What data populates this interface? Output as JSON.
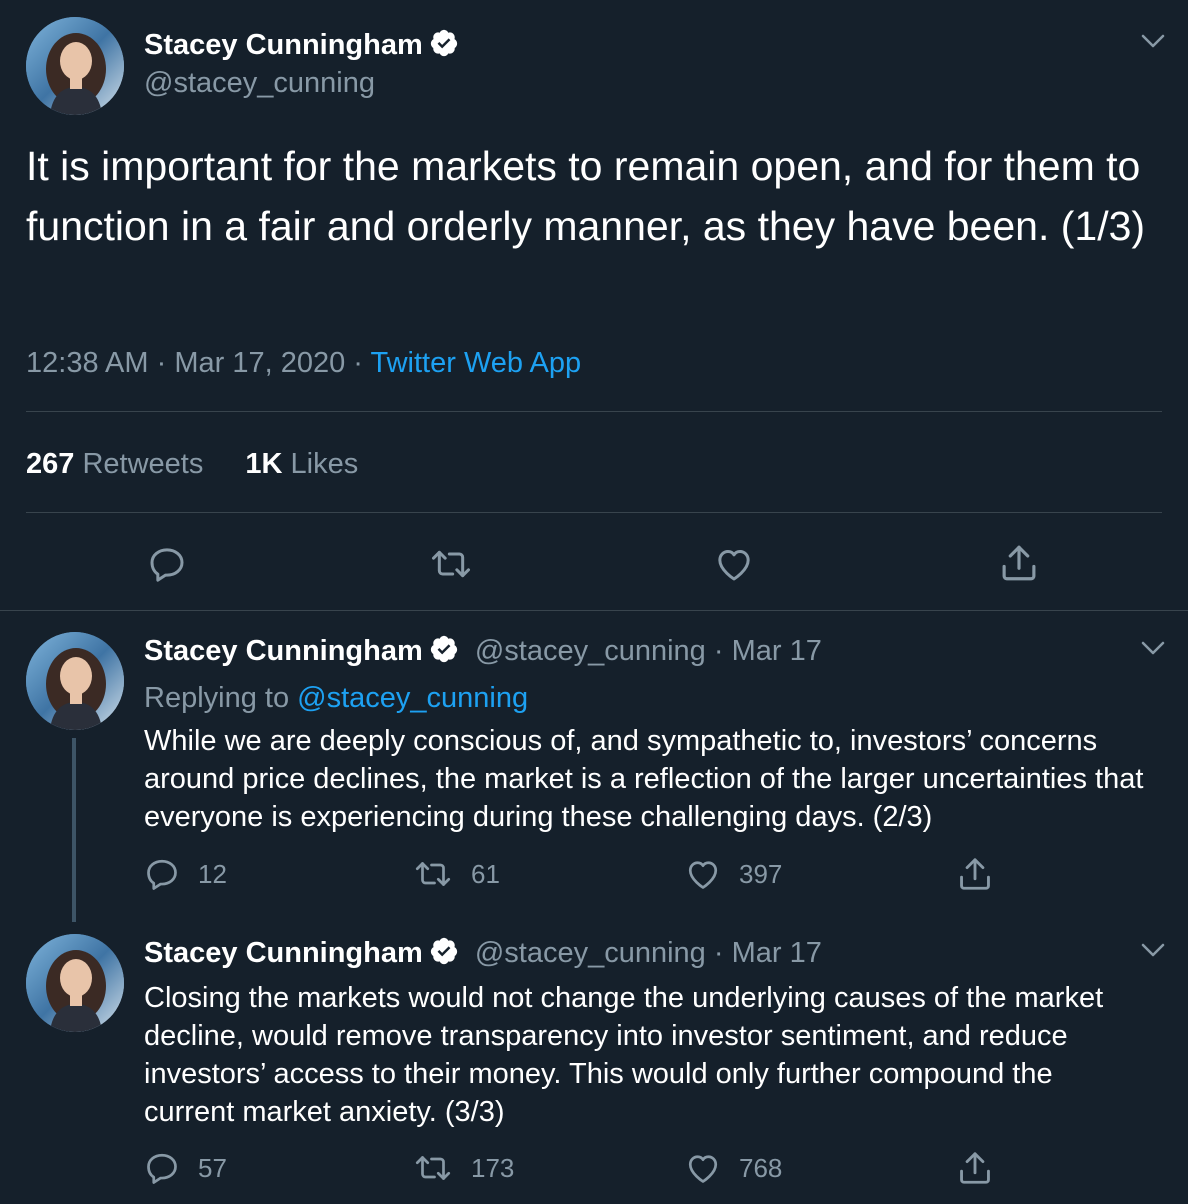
{
  "main_tweet": {
    "author_name": "Stacey Cunningham",
    "handle": "@stacey_cunning",
    "text": "It is important for the markets to remain open, and for them to function in a fair and orderly manner, as they have been. (1/3)",
    "time": "12:38 AM",
    "date": "Mar 17, 2020",
    "source": "Twitter Web App",
    "retweets_count": "267",
    "retweets_label": "Retweets",
    "likes_count": "1K",
    "likes_label": "Likes"
  },
  "replies": [
    {
      "author_name": "Stacey Cunningham",
      "handle": "@stacey_cunning",
      "date": "Mar 17",
      "replying_prefix": "Replying to",
      "replying_to": "@stacey_cunning",
      "text": "While we are deeply conscious of, and sympathetic to, investors’ concerns around price declines, the market is a reflection of the larger uncertainties that everyone is experiencing during these challenging days. (2/3)",
      "replies_count": "12",
      "retweets_count": "61",
      "likes_count": "397"
    },
    {
      "author_name": "Stacey Cunningham",
      "handle": "@stacey_cunning",
      "date": "Mar 17",
      "text": "Closing the markets would not change the underlying causes of the market decline, would remove transparency into investor sentiment, and reduce investors’ access to their money. This would only further compound the current market anxiety. (3/3)",
      "replies_count": "57",
      "retweets_count": "173",
      "likes_count": "768"
    }
  ],
  "separator": "·",
  "icons": {
    "verified": "verified-badge-icon",
    "chevron": "chevron-down-icon",
    "reply": "reply-icon",
    "retweet": "retweet-icon",
    "like": "heart-icon",
    "share": "share-icon"
  },
  "colors": {
    "background": "#15202b",
    "text": "#ffffff",
    "muted": "#8899a6",
    "link": "#1da1f2",
    "divider": "#38444d"
  }
}
